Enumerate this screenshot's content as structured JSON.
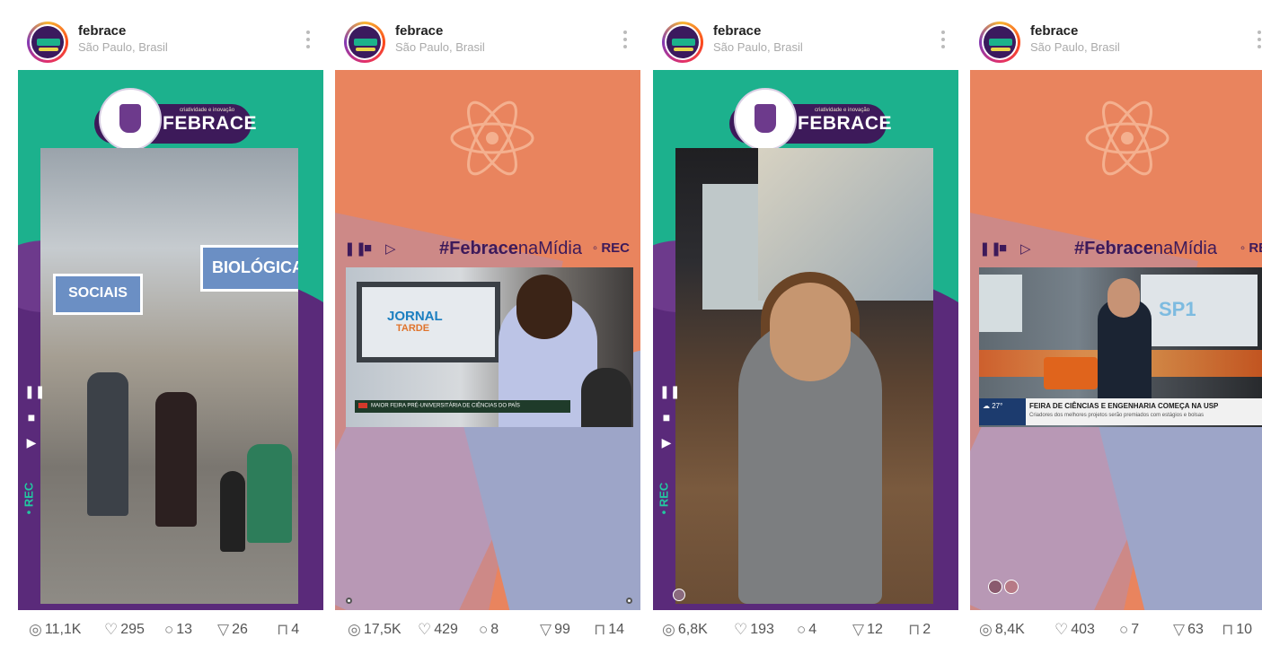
{
  "posts": [
    {
      "username": "febrace",
      "location": "São Paulo, Brasil",
      "media": {
        "type": "photo",
        "logo_text": "FEBRACE",
        "logo_tagline": "criatividade e inovação",
        "banners": [
          "SOCIAIS",
          "BIOLÓGICA"
        ],
        "rec_label": "• REC"
      },
      "stats": {
        "views": "11,1K",
        "likes": "295",
        "comments": "13",
        "shares": "26",
        "saves": "4"
      }
    },
    {
      "username": "febrace",
      "location": "São Paulo, Brasil",
      "media": {
        "type": "tv",
        "hashtag_bold": "#Febrace",
        "hashtag_rest": "naMídia",
        "rec_label": "◦ REC",
        "tv_brand_1": "JORNAL",
        "tv_brand_2": "TARDE",
        "lower_third": "MAIOR FEIRA PRÉ-UNIVERSITÁRIA DE CIÊNCIAS DO PAÍS"
      },
      "stats": {
        "views": "17,5K",
        "likes": "429",
        "comments": "8",
        "shares": "99",
        "saves": "14"
      }
    },
    {
      "username": "febrace",
      "location": "São Paulo, Brasil",
      "media": {
        "type": "photo",
        "logo_text": "FEBRACE",
        "logo_tagline": "criatividade e inovação",
        "rec_label": "• REC"
      },
      "stats": {
        "views": "6,8K",
        "likes": "193",
        "comments": "4",
        "shares": "12",
        "saves": "2"
      }
    },
    {
      "username": "febrace",
      "location": "São Paulo, Brasil",
      "media": {
        "type": "tv",
        "hashtag_bold": "#Febrace",
        "hashtag_rest": "naMídia",
        "rec_label": "◦ REC",
        "tv_brand": "SP1",
        "weather": "27°",
        "lower_third": "FEIRA DE CIÊNCIAS E ENGENHARIA COMEÇA NA USP",
        "lower_sub": "Criadores dos melhores projetos serão premiados com estágios e bolsas"
      },
      "stats": {
        "views": "8,4K",
        "likes": "403",
        "comments": "7",
        "shares": "63",
        "saves": "10"
      }
    }
  ],
  "icons": {
    "views": "eye-icon",
    "likes": "heart-icon",
    "comments": "comment-icon",
    "shares": "share-icon",
    "saves": "bookmark-icon"
  },
  "colors": {
    "teal": "#1cb18d",
    "purple": "#5a2a7a",
    "orange": "#e9845e",
    "lavender": "#9da5c8"
  }
}
